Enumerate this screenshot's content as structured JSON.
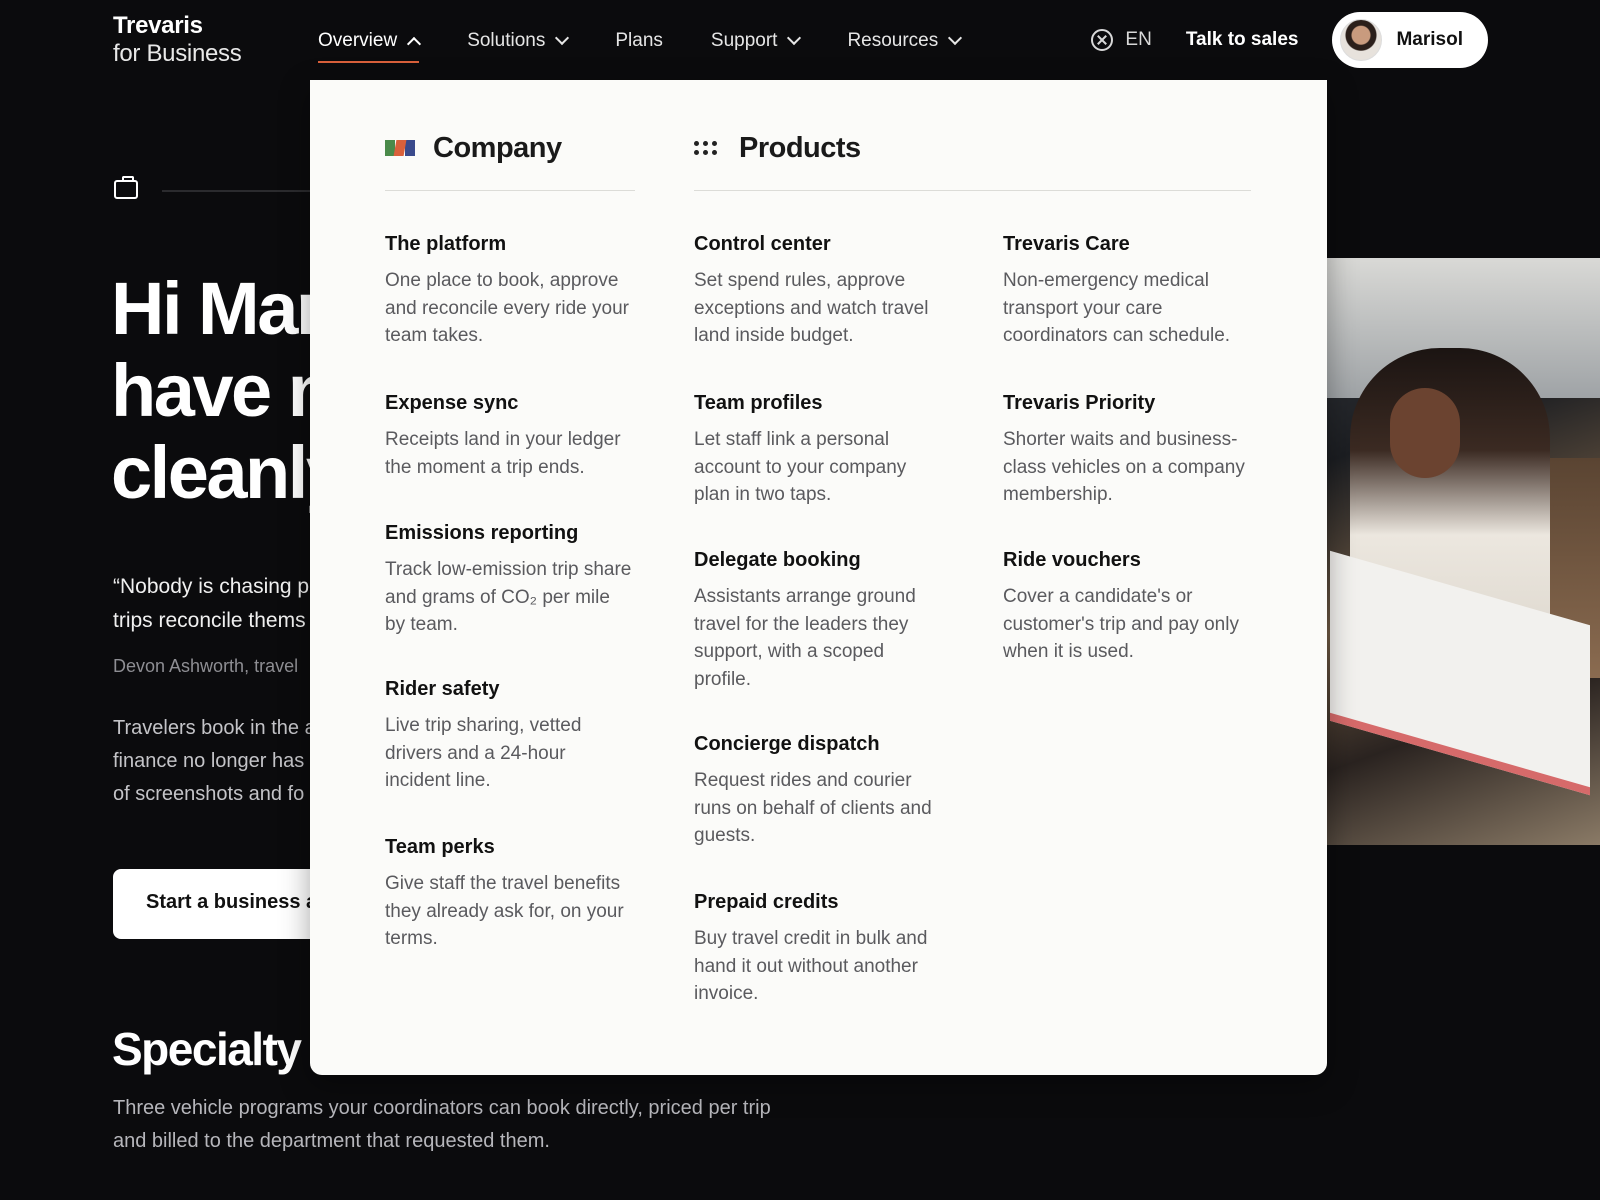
{
  "brand": {
    "line1": "Trevaris",
    "line2": "for Business"
  },
  "nav": {
    "items": [
      {
        "label": "Overview",
        "chevron": "up",
        "active": true
      },
      {
        "label": "Solutions",
        "chevron": "down"
      },
      {
        "label": "Plans"
      },
      {
        "label": "Support",
        "chevron": "down"
      },
      {
        "label": "Resources",
        "chevron": "down"
      }
    ],
    "language": "EN",
    "talk_to_sales": "Talk to sales",
    "user_name": "Marisol"
  },
  "hero": {
    "title_lines": [
      "Hi Mar",
      "have n",
      "cleanly"
    ],
    "quote_lines": [
      "“Nobody is chasing p",
      "trips reconcile thems"
    ],
    "attribution": "Devon Ashworth, travel",
    "body_lines": [
      "Travelers book in the a",
      "finance no longer has",
      "of screenshots and fo"
    ],
    "cta_label": "Start a business a"
  },
  "specialty": {
    "title": "Specialty r",
    "body_lines": [
      "Three vehicle programs your coordinators can book directly, priced per trip",
      "and billed to the department that requested them."
    ]
  },
  "mega_menu": {
    "company": {
      "heading": "Company",
      "icon": "flag-icon",
      "items": [
        {
          "title": "The platform",
          "desc": "One place to book, approve and reconcile every ride your team takes."
        },
        {
          "title": "Expense sync",
          "desc": "Receipts land in your ledger the moment a trip ends."
        },
        {
          "title": "Emissions reporting",
          "desc": "Track low-emission trip share and grams of CO₂ per mile by team."
        },
        {
          "title": "Rider safety",
          "desc": "Live trip sharing, vetted drivers and a 24-hour incident line."
        },
        {
          "title": "Team perks",
          "desc": "Give staff the travel benefits they already ask for, on your terms."
        }
      ]
    },
    "products": {
      "heading": "Products",
      "icon": "grid-dots-icon",
      "column1": [
        {
          "title": "Control center",
          "desc": "Set spend rules, approve exceptions and watch travel land inside budget."
        },
        {
          "title": "Team profiles",
          "desc": "Let staff link a personal account to your company plan in two taps."
        },
        {
          "title": "Delegate booking",
          "desc": "Assistants arrange ground travel for the leaders they support, with a scoped profile."
        },
        {
          "title": "Concierge dispatch",
          "desc": "Request rides and courier runs on behalf of clients and guests."
        },
        {
          "title": "Prepaid credits",
          "desc": "Buy travel credit in bulk and hand it out without another invoice."
        }
      ],
      "column2": [
        {
          "title": "Trevaris Care",
          "desc": "Non-emergency medical transport your care coordinators can schedule."
        },
        {
          "title": "Trevaris Priority",
          "desc": "Shorter waits and business-class vehicles on a company membership."
        },
        {
          "title": "Ride vouchers",
          "desc": "Cover a candidate's or customer's trip and pay only when it is used."
        }
      ]
    }
  },
  "colors": {
    "background": "#0b0b0d",
    "menu_bg": "#fbfbf9",
    "accent": "#d9603b"
  }
}
